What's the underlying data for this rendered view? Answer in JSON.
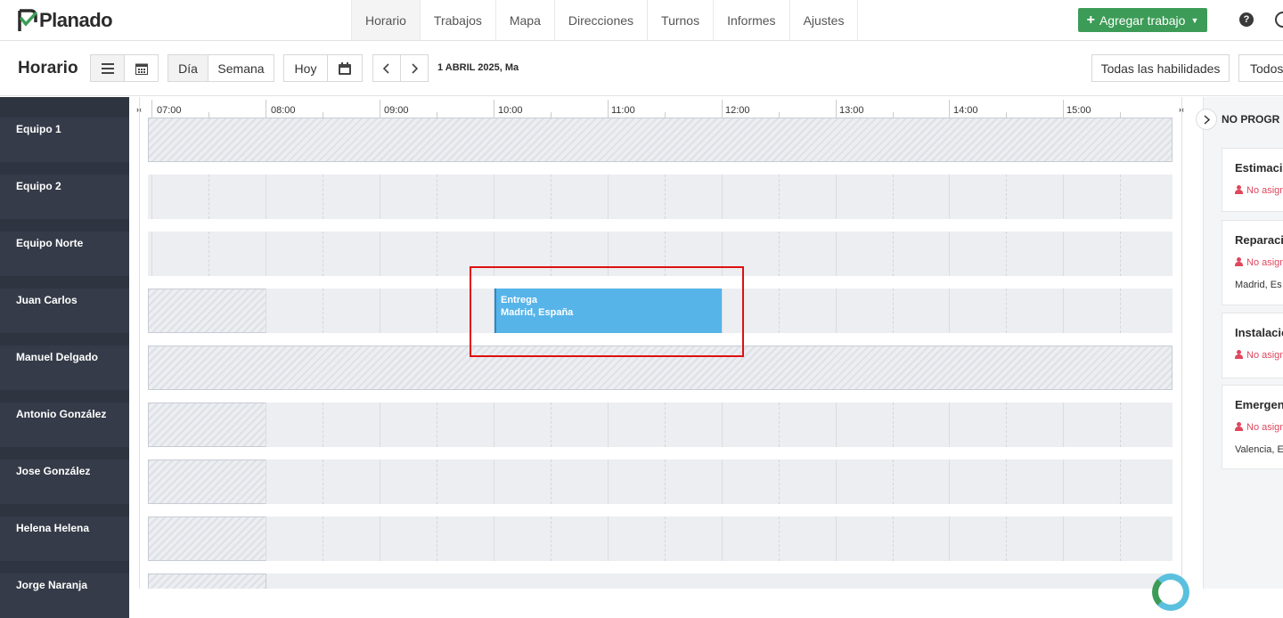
{
  "app": {
    "name": "Planado"
  },
  "nav": {
    "tabs": [
      "Horario",
      "Trabajos",
      "Mapa",
      "Direcciones",
      "Turnos",
      "Informes",
      "Ajustes"
    ],
    "add_job_label": "Agregar trabajo",
    "help_glyph": "?"
  },
  "toolbar": {
    "title": "Horario",
    "view_day": "Día",
    "view_week": "Semana",
    "today": "Hoy",
    "date": "1 ABRIL 2025, Ma",
    "skills_filter": "Todas las habilidades",
    "all_filter": "Todos"
  },
  "timeline": {
    "hours": [
      "07:00",
      "08:00",
      "09:00",
      "10:00",
      "11:00",
      "12:00",
      "13:00",
      "14:00",
      "15:00"
    ],
    "resources": [
      "Equipo 1",
      "Equipo 2",
      "Equipo Norte",
      "Juan Carlos",
      "Manuel Delgado",
      "Antonio González",
      "Jose González",
      "Helena Helena",
      "Jorge Naranja"
    ],
    "job": {
      "title": "Entrega",
      "address": "Madrid, España"
    }
  },
  "unscheduled": {
    "title": "NO PROGR",
    "cards": [
      {
        "title": "Estimacio",
        "assignee": "No asign",
        "address": ""
      },
      {
        "title": "Reparaci",
        "assignee": "No asign",
        "address": "Madrid, Es"
      },
      {
        "title": "Instalacio",
        "assignee": "No asign",
        "address": ""
      },
      {
        "title": "Emergen",
        "assignee": "No asign",
        "address": "Valencia, E"
      }
    ]
  },
  "colors": {
    "accent": "#3c9c57",
    "job": "#56b4e9",
    "sidebar": "#2e3440",
    "unassigned": "#e0475c"
  }
}
